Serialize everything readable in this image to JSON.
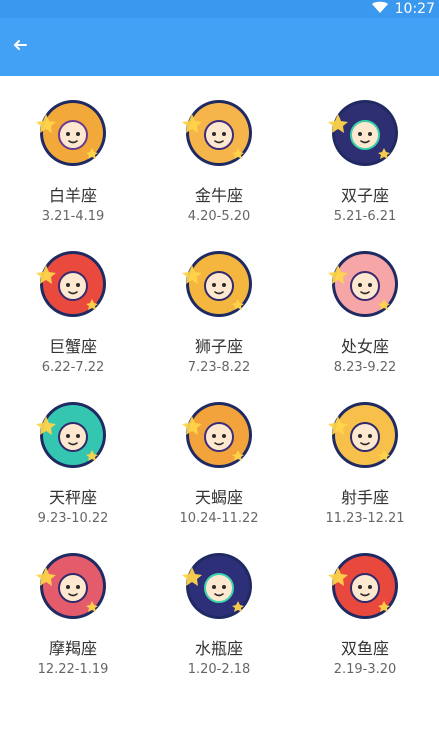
{
  "status": {
    "time": "10:27"
  },
  "colors": {
    "statusbar": "#3a99ef",
    "appbar": "#42a1f5"
  },
  "signs": [
    {
      "name": "白羊座",
      "range": "3.21-4.19",
      "icon": "aries-icon",
      "color": "#f2a93a",
      "stroke": "#6a3b8f"
    },
    {
      "name": "金牛座",
      "range": "4.20-5.20",
      "icon": "taurus-icon",
      "color": "#f5b54a",
      "stroke": "#3b2d7a"
    },
    {
      "name": "双子座",
      "range": "5.21-6.21",
      "icon": "gemini-icon",
      "color": "#2e2f72",
      "stroke": "#39d0a8"
    },
    {
      "name": "巨蟹座",
      "range": "6.22-7.22",
      "icon": "cancer-icon",
      "color": "#e94a3d",
      "stroke": "#3a2a6f"
    },
    {
      "name": "狮子座",
      "range": "7.23-8.22",
      "icon": "leo-icon",
      "color": "#f4b63e",
      "stroke": "#2f2a6b"
    },
    {
      "name": "处女座",
      "range": "8.23-9.22",
      "icon": "virgo-icon",
      "color": "#f6a6a6",
      "stroke": "#3a2a6f"
    },
    {
      "name": "天秤座",
      "range": "9.23-10.22",
      "icon": "libra-icon",
      "color": "#35c6b2",
      "stroke": "#2f2a6b"
    },
    {
      "name": "天蝎座",
      "range": "10.24-11.22",
      "icon": "scorpio-icon",
      "color": "#f3a33c",
      "stroke": "#3b2d7a"
    },
    {
      "name": "射手座",
      "range": "11.23-12.21",
      "icon": "sagittarius-icon",
      "color": "#f7c04a",
      "stroke": "#2f2a6b"
    },
    {
      "name": "摩羯座",
      "range": "12.22-1.19",
      "icon": "capricorn-icon",
      "color": "#e45b6b",
      "stroke": "#2f2a6b"
    },
    {
      "name": "水瓶座",
      "range": "1.20-2.18",
      "icon": "aquarius-icon",
      "color": "#2d2f78",
      "stroke": "#3bd5ae"
    },
    {
      "name": "双鱼座",
      "range": "2.19-3.20",
      "icon": "pisces-icon",
      "color": "#e9483d",
      "stroke": "#2f2a6b"
    }
  ]
}
